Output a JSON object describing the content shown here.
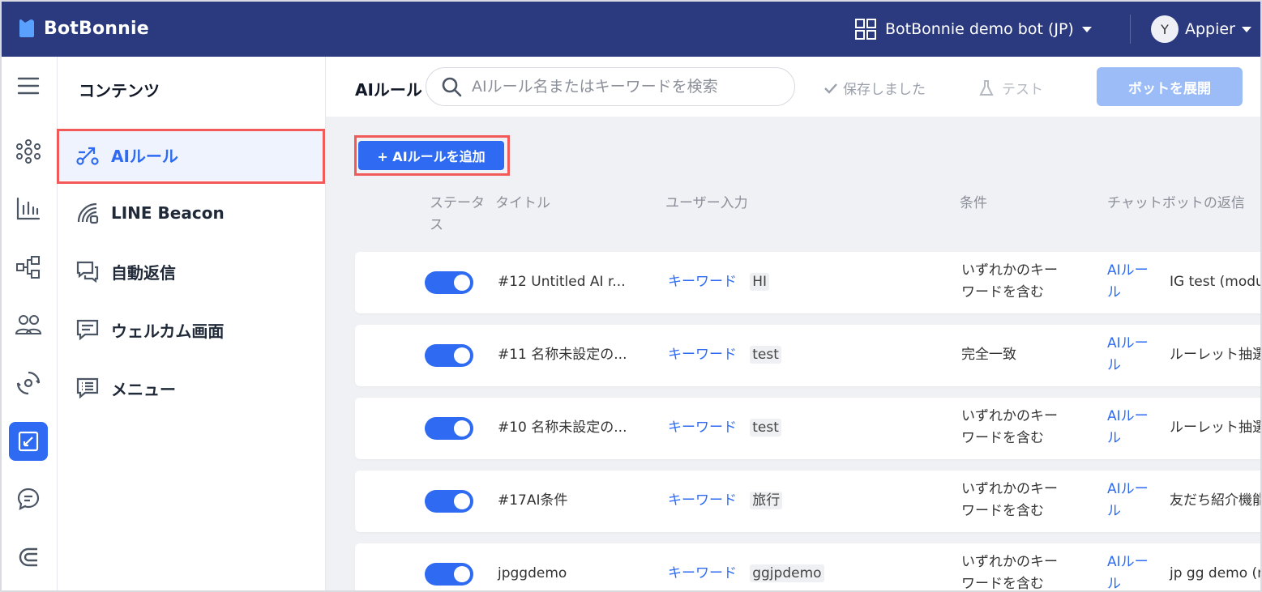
{
  "app": {
    "name": "BotBonnie"
  },
  "header": {
    "bot_name": "BotBonnie demo bot (JP)",
    "user_initial": "Y",
    "user_name": "Appier"
  },
  "rail": {
    "items": [
      {
        "name": "menu-icon"
      },
      {
        "name": "network-icon"
      },
      {
        "name": "bar-chart-icon"
      },
      {
        "name": "flow-icon"
      },
      {
        "name": "users-icon"
      },
      {
        "name": "cycle-icon"
      },
      {
        "name": "content-edit-icon",
        "active": true
      },
      {
        "name": "chat-bubble-icon"
      },
      {
        "name": "magnet-icon"
      }
    ]
  },
  "sidebar": {
    "title": "コンテンツ",
    "items": [
      {
        "label": "AIルール",
        "icon": "ai-rule-icon",
        "active": true
      },
      {
        "label": "LINE Beacon",
        "icon": "beacon-icon"
      },
      {
        "label": "自動返信",
        "icon": "auto-reply-icon"
      },
      {
        "label": "ウェルカム画面",
        "icon": "welcome-screen-icon"
      },
      {
        "label": "メニュー",
        "icon": "menu-list-icon"
      }
    ]
  },
  "toolbar": {
    "title": "AIルール",
    "search_placeholder": "AIルール名またはキーワードを検索",
    "saved_label": "保存しました",
    "test_label": "テスト",
    "deploy_label": "ボットを展開"
  },
  "add_button_label": "+ AIルールを追加",
  "table": {
    "headers": {
      "status_line1": "ステータ",
      "status_line2": "ス",
      "title": "タイトル",
      "user_input": "ユーザー入力",
      "condition": "条件",
      "reply": "チャットボットの返信"
    },
    "rows": [
      {
        "enabled": true,
        "title": "#12 Untitled AI r...",
        "input_type": "キーワード",
        "keyword": "HI",
        "cond1": "いずれかのキー",
        "cond2": "ワードを含む",
        "reply_type1": "AIルー",
        "reply_type2": "ル",
        "reply": "IG test (modu"
      },
      {
        "enabled": true,
        "title": "#11 名称未設定の...",
        "input_type": "キーワード",
        "keyword": "test",
        "cond1": "完全一致",
        "cond2": "",
        "reply_type1": "AIルー",
        "reply_type2": "ル",
        "reply": "ルーレット抽選"
      },
      {
        "enabled": true,
        "title": "#10 名称未設定の...",
        "input_type": "キーワード",
        "keyword": "test",
        "cond1": "いずれかのキー",
        "cond2": "ワードを含む",
        "reply_type1": "AIルー",
        "reply_type2": "ル",
        "reply": "ルーレット抽選"
      },
      {
        "enabled": true,
        "title": "#17AI条件",
        "input_type": "キーワード",
        "keyword": "旅行",
        "cond1": "いずれかのキー",
        "cond2": "ワードを含む",
        "reply_type1": "AIルー",
        "reply_type2": "ル",
        "reply": "友だち紹介機能"
      },
      {
        "enabled": true,
        "title": "jpggdemo",
        "input_type": "キーワード",
        "keyword": "ggjpdemo",
        "cond1": "いずれかのキー",
        "cond2": "ワードを含む",
        "reply_type1": "AIルー",
        "reply_type2": "ル",
        "reply": "jp gg demo (m"
      }
    ]
  },
  "colors": {
    "header_bg": "#2b3a7e",
    "accent": "#2e6bf2",
    "highlight": "#f25a5a",
    "deploy_disabled": "#9bbcf7"
  }
}
